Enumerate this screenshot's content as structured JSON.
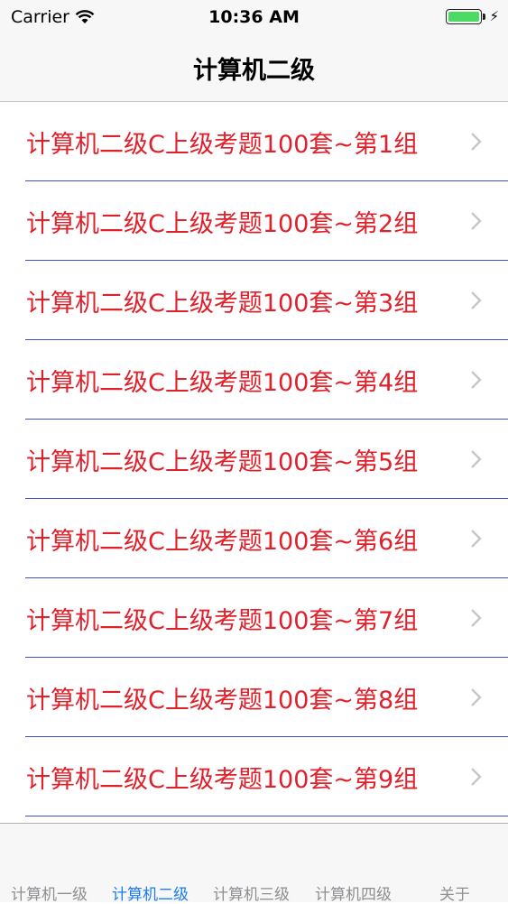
{
  "status_bar": {
    "carrier": "Carrier",
    "time": "10:36 AM",
    "battery_level": 1.0,
    "battery_color": "#4cd964"
  },
  "nav": {
    "title": "计算机二级"
  },
  "list": {
    "items": [
      {
        "label": "计算机二级C上级考题100套~第1组"
      },
      {
        "label": "计算机二级C上级考题100套~第2组"
      },
      {
        "label": "计算机二级C上级考题100套~第3组"
      },
      {
        "label": "计算机二级C上级考题100套~第4组"
      },
      {
        "label": "计算机二级C上级考题100套~第5组"
      },
      {
        "label": "计算机二级C上级考题100套~第6组"
      },
      {
        "label": "计算机二级C上级考题100套~第7组"
      },
      {
        "label": "计算机二级C上级考题100套~第8组"
      },
      {
        "label": "计算机二级C上级考题100套~第9组"
      }
    ],
    "label_color": "#e0202a",
    "separator_color": "#3b4fd1",
    "chevron_icon": "chevron-right-icon"
  },
  "tabbar": {
    "tabs": [
      {
        "label": "计算机一级",
        "active": false
      },
      {
        "label": "计算机二级",
        "active": true
      },
      {
        "label": "计算机三级",
        "active": false
      },
      {
        "label": "计算机四级",
        "active": false
      },
      {
        "label": "关于",
        "active": false
      }
    ],
    "active_color": "#1a7cf0",
    "inactive_color": "#8e8e93"
  }
}
